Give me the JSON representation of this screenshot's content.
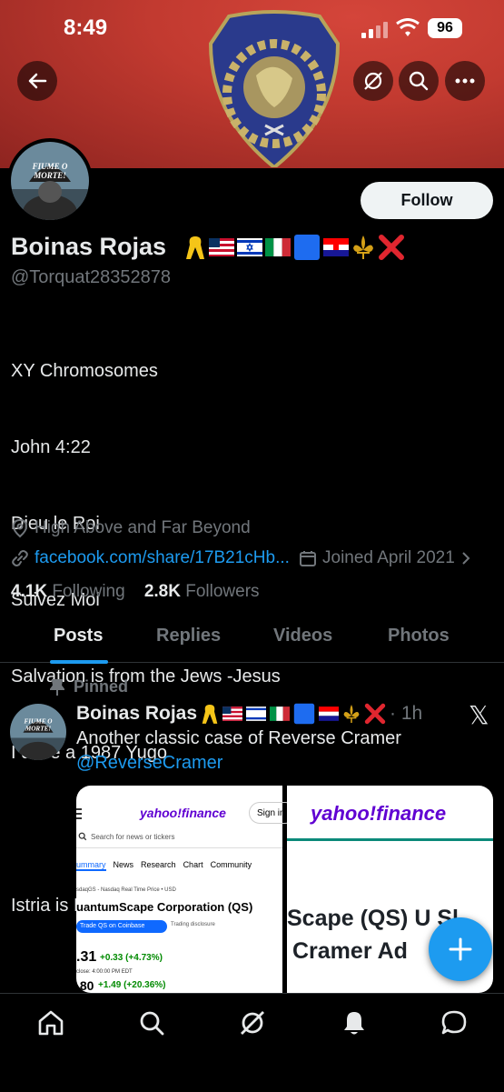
{
  "status": {
    "time": "8:49",
    "battery": "96"
  },
  "profile": {
    "name": "Boinas Rojas",
    "handle": "@Torquat28352878",
    "follow_label": "Follow",
    "avatar_text": "FIUME O MORTE!",
    "bio_lines": [
      "XY Chromosomes",
      "John 4:22",
      "Dieu le Roi",
      "Suivez Moi",
      "Salvation is from the Jews -Jesus",
      "I drive a 1987 Yugo",
      "",
      "Istria is Italy"
    ],
    "location": "High Above and Far Beyond",
    "website": "facebook.com/share/17B21cHb...",
    "joined": "Joined April 2021",
    "following_count": "4.1K",
    "following_label": "Following",
    "followers_count": "2.8K",
    "followers_label": "Followers"
  },
  "tabs": [
    {
      "label": "Posts"
    },
    {
      "label": "Replies"
    },
    {
      "label": "Videos"
    },
    {
      "label": "Photos"
    }
  ],
  "post": {
    "pinned_label": "Pinned",
    "author": "Boinas Rojas",
    "time": "1h",
    "text": "Another classic case of Reverse Cramer",
    "mention": "@ReverseCramer",
    "media1": {
      "brand": "yahoo!finance",
      "sign_in": "Sign in",
      "search_placeholder": "Search for news or tickers",
      "nav": [
        "ummary",
        "News",
        "Research",
        "Chart",
        "Community"
      ],
      "exchange": "sdaqGS - Nasdaq Real Time Price • USD",
      "company": "uantumScape Corporation (QS)",
      "trade_btn": "Trade QS on Coinbase",
      "disclosure": "Trading disclosure",
      "price": ".31",
      "change": "+0.33 (+4.73%)",
      "close": "close: 4:00:00 PM EDT",
      "after_price": ".80",
      "after_change": "+1.49 (+20.36%)"
    },
    "media2": {
      "brand": "yahoo!finance",
      "headline1": "Scape (QS) U",
      "headline1b": "Sl",
      "headline2": "Cramer Ad"
    }
  },
  "colors": {
    "accent": "#1d9bf0",
    "muted": "#71767b",
    "text": "#e7e9ea",
    "bg": "#000000"
  }
}
